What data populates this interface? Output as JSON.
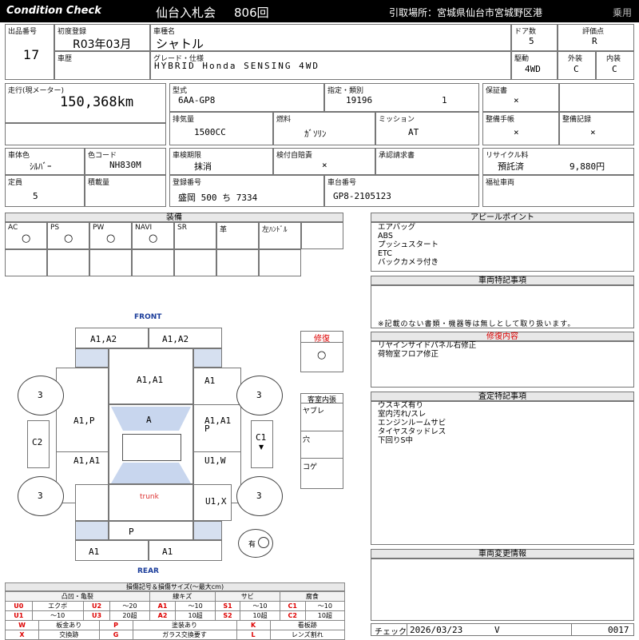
{
  "header": {
    "title": "Condition Check",
    "auction": "仙台入札会",
    "round": "806回",
    "pickup": "引取場所：宮城県仙台市宮城野区港",
    "vehicle_type": "乗用"
  },
  "top": {
    "lot_label": "出品番号",
    "lot": "17",
    "first_reg_label": "初度登録",
    "first_reg": "R03年03月",
    "history_label": "車歴",
    "model_label": "車種名",
    "model": "シャトル",
    "grade_label": "グレード・仕様",
    "grade": "HYBRID  Honda  SENSING  4WD",
    "doors_label": "ドア数",
    "doors": "5",
    "drive_label": "駆動",
    "drive": "4WD",
    "score_label": "評価点",
    "score": "R",
    "ext_label": "外装",
    "ext": "C",
    "int_label": "内装",
    "int": "C"
  },
  "spec": {
    "mileage_label": "走行(現メーター)",
    "mileage": "150,368km",
    "type_label": "型式",
    "type": "6AA-GP8",
    "designation_label": "指定・類別",
    "designation": "19196",
    "category": "1",
    "displacement_label": "排気量",
    "displacement": "1500CC",
    "fuel_label": "燃料",
    "fuel": "ｶﾞｿﾘﾝ",
    "mission_label": "ミッション",
    "mission": "AT",
    "warranty_label": "保証書",
    "warranty": "×",
    "manual_label": "整備手帳",
    "manual": "×",
    "record_label": "整備記録",
    "record": "×",
    "color_label": "車体色",
    "color": "ｼﾙﾊﾞｰ",
    "color_code_label": "色コード",
    "color_code": "NH830M",
    "inspection_label": "車検期限",
    "inspection": "抹消",
    "insurance_label": "検付自賠責",
    "insurance": "×",
    "approval_label": "承認請求書",
    "recycle_label": "リサイクル料",
    "recycle_status": "預託済",
    "recycle_fee": "9,880円",
    "capacity_label": "定員",
    "capacity": "5",
    "load_label": "積載量",
    "plate_label": "登録番号",
    "plate": "盛岡   500 ち  7334",
    "chassis_label": "車台番号",
    "chassis": "GP8-2105123",
    "welfare_label": "福祉車両"
  },
  "equipment": {
    "title": "装備",
    "items": [
      {
        "name": "AC",
        "mark": "○"
      },
      {
        "name": "PS",
        "mark": "○"
      },
      {
        "name": "PW",
        "mark": "○"
      },
      {
        "name": "NAVI",
        "mark": "○"
      },
      {
        "name": "SR",
        "mark": ""
      },
      {
        "name": "革",
        "mark": ""
      },
      {
        "name": "左ﾊﾝﾄﾞﾙ",
        "mark": ""
      }
    ]
  },
  "appeal": {
    "title": "アピールポイント",
    "lines": [
      "エアバッグ",
      "ABS",
      "プッシュスタート",
      "ETC",
      "バックカメラ付き"
    ]
  },
  "special": {
    "title": "車両特記事項",
    "note": "※記載のない書類・機器等は無しとして取り扱います。"
  },
  "repair": {
    "title": "修復内容",
    "lines": [
      "リヤインサイドパネル右修正",
      "荷物室フロア修正"
    ]
  },
  "assessment": {
    "title": "査定特記事項",
    "lines": [
      "ウスキズ有り",
      "室内汚れ/スレ",
      "エンジンルームサビ",
      "タイヤスタッドレス",
      "下回りS中"
    ]
  },
  "change": {
    "title": "車両変更情報"
  },
  "diagram": {
    "front": "FRONT",
    "rear": "REAR",
    "trunk": "trunk",
    "top_left": "A1,A2",
    "top_right": "A1,A2",
    "hood": "A1,A1",
    "fender_r": "A1",
    "door_l1": "A1,P",
    "roof": "A",
    "door_r1": "A1,A1",
    "door_r1b": "P",
    "door_l2": "A1,A1",
    "door_r2": "U1,W",
    "quarter_r": "U1,X",
    "tailgate": "P",
    "bumper_l": "A1",
    "bumper_r": "A1",
    "tire_fl": "3",
    "tire_fr": "3",
    "tire_rl": "3",
    "tire_rr": "3",
    "c2": "C2",
    "c1": "C1",
    "repair_label": "修復",
    "repair_mark": "○",
    "interior_label": "客室内張",
    "interior_items": [
      "ヤブレ",
      "穴",
      "コゲ"
    ],
    "presence": "有"
  },
  "legend": {
    "title": "損傷記号＆損傷サイズ(～最大cm)",
    "cats": [
      "凸凹・亀裂",
      "線キズ",
      "サビ",
      "腐食"
    ],
    "rows": [
      [
        [
          "U0",
          "エクボ"
        ],
        [
          "U2",
          "～20"
        ],
        [
          "A1",
          "～10"
        ],
        [
          "S1",
          "～10"
        ],
        [
          "C1",
          "～10"
        ]
      ],
      [
        [
          "U1",
          "～10"
        ],
        [
          "U3",
          "20超"
        ],
        [
          "A2",
          "10超"
        ],
        [
          "S2",
          "10超"
        ],
        [
          "C2",
          "10超"
        ]
      ]
    ],
    "codes": [
      [
        [
          "W",
          "板金あり"
        ],
        [
          "P",
          "塗装あり"
        ],
        [
          "K",
          "看板跡"
        ]
      ],
      [
        [
          "X",
          "交換跡"
        ],
        [
          "G",
          "ガラス交換要す"
        ],
        [
          "L",
          "レンズ割れ"
        ]
      ]
    ]
  },
  "footer": {
    "check_label": "チェック",
    "date": "2026/03/23",
    "checker": "V",
    "number": "0017"
  }
}
